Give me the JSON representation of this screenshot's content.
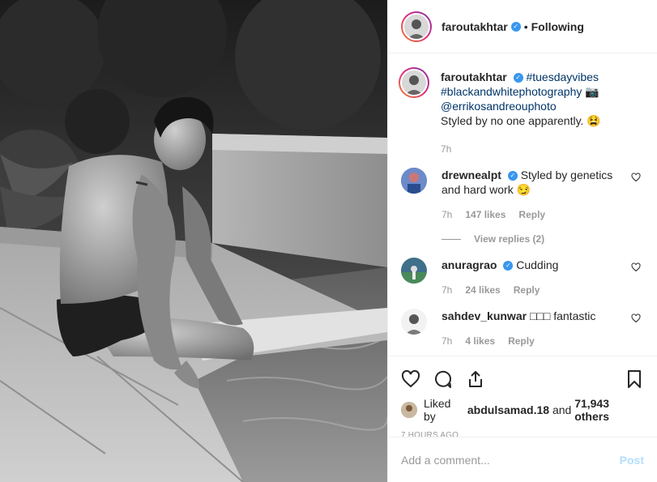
{
  "post": {
    "author": "faroutakhtar",
    "follow_status": "Following",
    "separator": "•"
  },
  "caption": {
    "username": "faroutakhtar",
    "hashtag1": "#tuesdayvibes",
    "hashtag2": "#blackandwhitephotography",
    "camera_emoji": "📷",
    "mention": "@errikosandreouphoto",
    "text": "Styled by no one apparently. 😫",
    "time": "7h"
  },
  "comments": [
    {
      "username": "drewnealpt",
      "verified": true,
      "text": "Styled by genetics and hard work 😏",
      "time": "7h",
      "likes": "147 likes",
      "reply": "Reply",
      "view_replies": "View replies (2)"
    },
    {
      "username": "anuragrao",
      "verified": true,
      "text": "Cudding",
      "time": "7h",
      "likes": "24 likes",
      "reply": "Reply"
    },
    {
      "username": "sahdev_kunwar",
      "verified": false,
      "text": "□□□ fantastic",
      "time": "7h",
      "likes": "4 likes",
      "reply": "Reply"
    }
  ],
  "likes": {
    "prefix": "Liked by",
    "user": "abdulsamad.18",
    "and": "and",
    "count": "71,943 others"
  },
  "time_ago": "7 HOURS AGO",
  "add_comment": {
    "placeholder": "Add a comment...",
    "post_label": "Post"
  },
  "icons": {
    "verified": "verified-badge-icon",
    "like": "heart-icon",
    "comment": "comment-icon",
    "share": "share-icon",
    "save": "bookmark-icon"
  },
  "colors": {
    "verified": "#3897f0",
    "link": "#003569",
    "muted": "#999999",
    "post_button": "#b2dffc"
  }
}
